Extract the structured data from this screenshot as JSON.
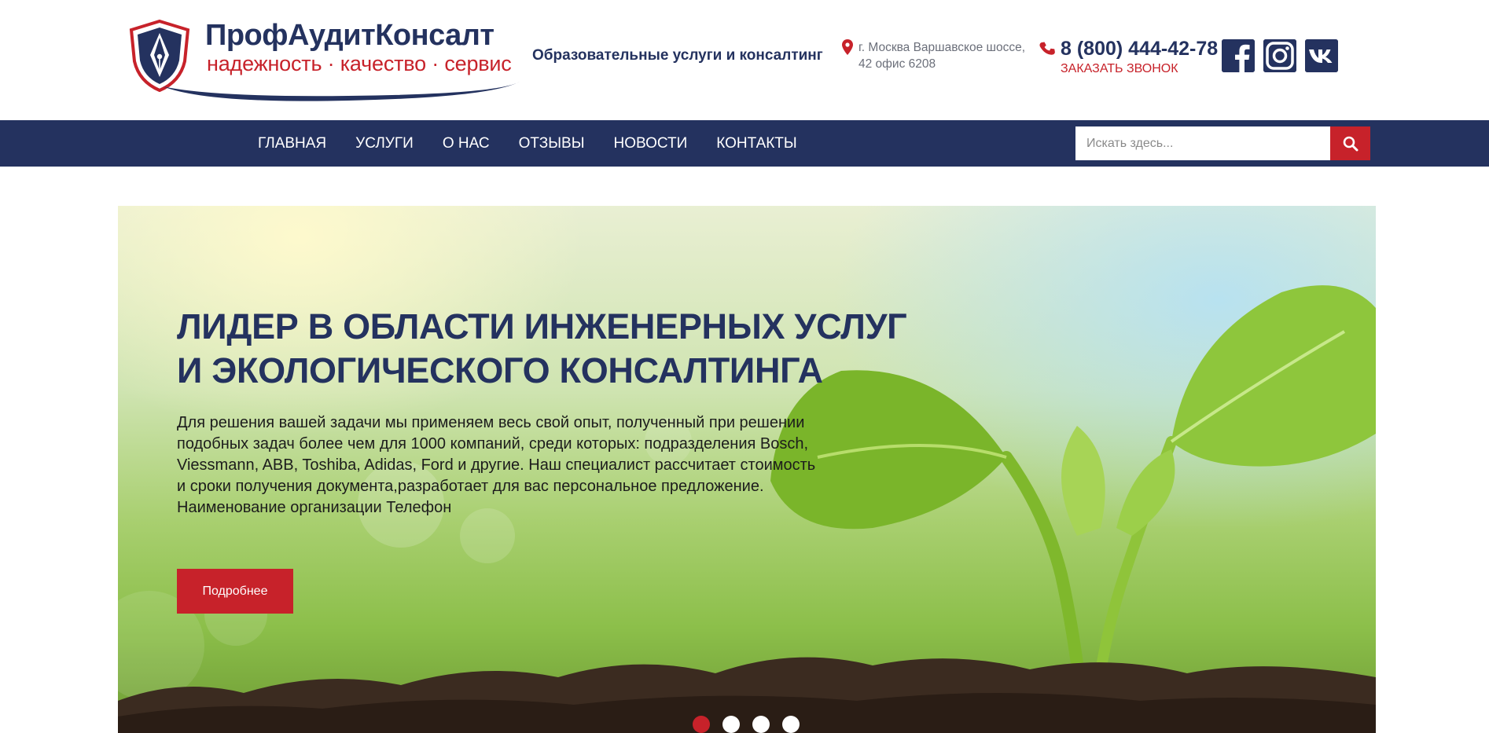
{
  "header": {
    "logo": {
      "title": "ПрофАудитКонсалт",
      "slogan": "надежность · качество · сервис"
    },
    "tagline": "Образовательные услуги и консалтинг",
    "address": "г. Москва Варшавское шоссе, 42 офис 6208",
    "phone": "8 (800) 444-42-78",
    "callback_label": "ЗАКАЗАТЬ ЗВОНОК",
    "social": [
      "facebook-icon",
      "instagram-icon",
      "vk-icon"
    ]
  },
  "nav": {
    "items": [
      {
        "label": "ГЛАВНАЯ"
      },
      {
        "label": "УСЛУГИ"
      },
      {
        "label": "О НАС"
      },
      {
        "label": "ОТЗЫВЫ"
      },
      {
        "label": "НОВОСТИ"
      },
      {
        "label": "КОНТАКТЫ"
      }
    ],
    "search": {
      "placeholder": "Искать здесь...",
      "value": ""
    }
  },
  "hero": {
    "title_line1": "ЛИДЕР В ОБЛАСТИ ИНЖЕНЕРНЫХ УСЛУГ",
    "title_line2": "И ЭКОЛОГИЧЕСКОГО КОНСАЛТИНГА",
    "text": "Для решения вашей задачи мы применяем весь свой опыт, полученный при решении подобных задач более чем для 1000 компаний, среди которых: подразделения Bosch, Viessmann, ABB, Toshiba, Adidas, Ford и другие. Наш специалист рассчитает стоимость и сроки получения документа,разработает для вас персональное предложение. Наименование организации Телефон",
    "button_label": "Подробнее",
    "slides_total": 4,
    "active_slide": 1
  },
  "colors": {
    "navy": "#24325f",
    "red": "#c7222a",
    "white": "#ffffff"
  }
}
